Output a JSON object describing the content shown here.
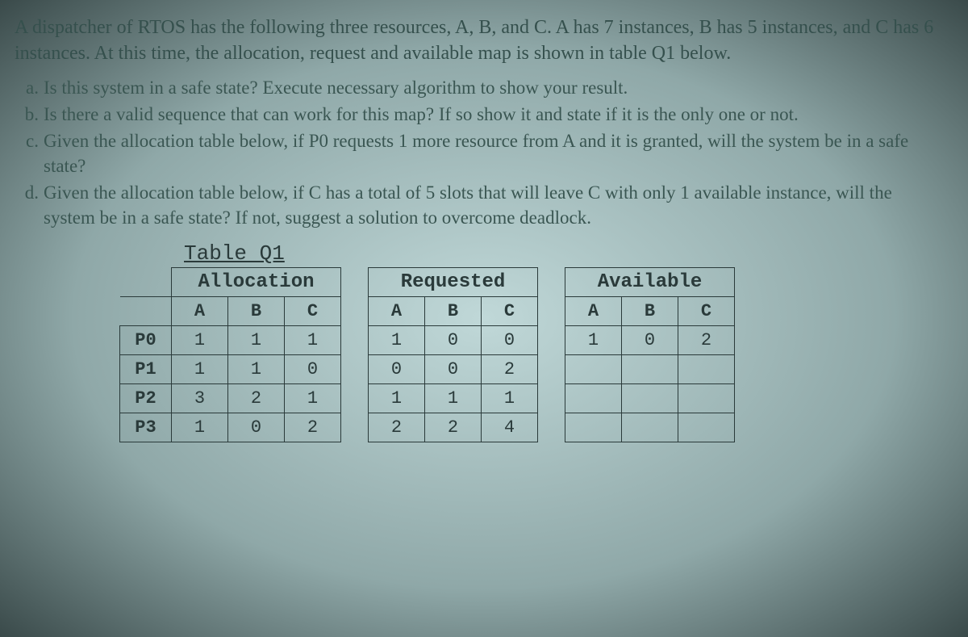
{
  "intro": "A dispatcher of RTOS has the following three resources, A, B, and C. A has 7 instances, B has 5 instances, and C has 6 instances. At this time, the allocation, request and available map is shown in table Q1 below.",
  "questions": {
    "a": {
      "marker": "a.",
      "text": "Is this system in a safe state? Execute necessary algorithm to show your result."
    },
    "b": {
      "marker": "b.",
      "text": "Is there a valid sequence that can work for this map?  If so show it and state if it is the only one or not."
    },
    "c": {
      "marker": "c.",
      "text": "Given the allocation table below, if P0 requests 1 more resource from A and it is granted, will the system be in a safe state?"
    },
    "d": {
      "marker": "d.",
      "text": "Given the allocation table below, if C has a total of 5 slots that will leave C with only 1 available instance, will the system be in a safe state? If not, suggest a solution to overcome deadlock."
    }
  },
  "table": {
    "title": "Table Q1",
    "groups": {
      "allocation": "Allocation",
      "requested": "Requested",
      "available": "Available"
    },
    "cols": {
      "A": "A",
      "B": "B",
      "C": "C"
    },
    "rows": [
      {
        "proc": "P0",
        "alloc": {
          "A": "1",
          "B": "1",
          "C": "1"
        },
        "req": {
          "A": "1",
          "B": "0",
          "C": "0"
        },
        "avail": {
          "A": "1",
          "B": "0",
          "C": "2"
        }
      },
      {
        "proc": "P1",
        "alloc": {
          "A": "1",
          "B": "1",
          "C": "0"
        },
        "req": {
          "A": "0",
          "B": "0",
          "C": "2"
        }
      },
      {
        "proc": "P2",
        "alloc": {
          "A": "3",
          "B": "2",
          "C": "1"
        },
        "req": {
          "A": "1",
          "B": "1",
          "C": "1"
        }
      },
      {
        "proc": "P3",
        "alloc": {
          "A": "1",
          "B": "0",
          "C": "2"
        },
        "req": {
          "A": "2",
          "B": "2",
          "C": "4"
        }
      }
    ]
  }
}
